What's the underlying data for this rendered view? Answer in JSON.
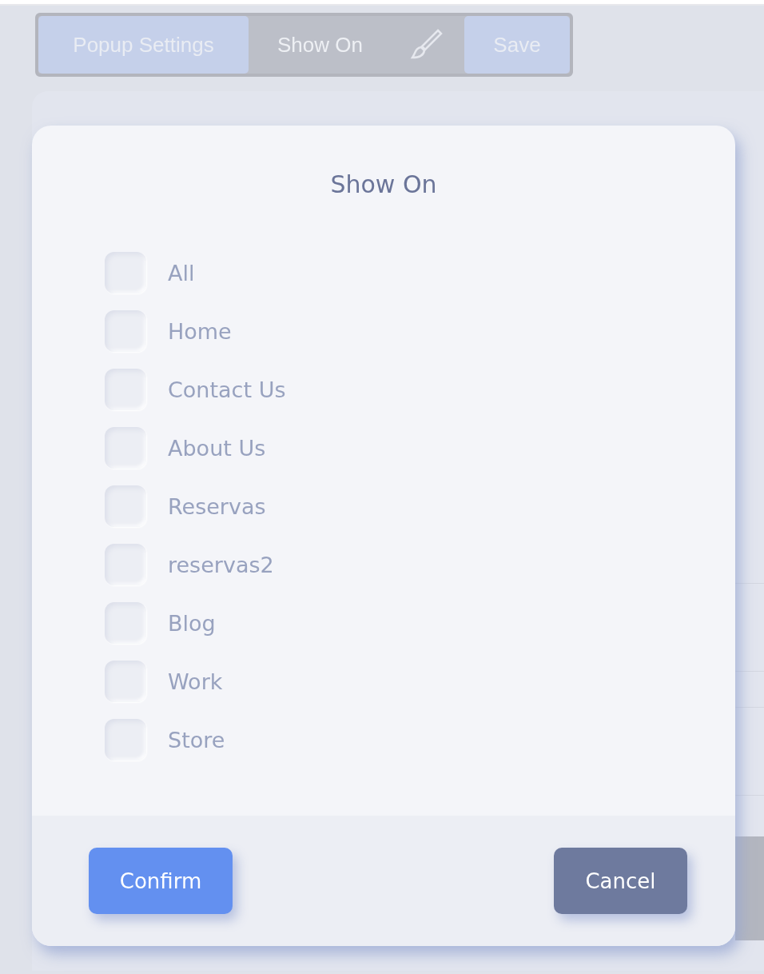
{
  "toolbar": {
    "tabs": [
      {
        "label": "Popup Settings",
        "selected": false
      },
      {
        "label": "Show On",
        "selected": true
      }
    ],
    "save": "Save"
  },
  "dialog": {
    "title": "Show On",
    "options": [
      {
        "label": "All",
        "checked": false
      },
      {
        "label": "Home",
        "checked": false
      },
      {
        "label": "Contact Us",
        "checked": false
      },
      {
        "label": "About Us",
        "checked": false
      },
      {
        "label": "Reservas",
        "checked": false
      },
      {
        "label": "reservas2",
        "checked": false
      },
      {
        "label": "Blog",
        "checked": false
      },
      {
        "label": "Work",
        "checked": false
      },
      {
        "label": "Store",
        "checked": false
      }
    ],
    "buttons": [
      {
        "label": "Confirm",
        "kind": "primary"
      },
      {
        "label": "Cancel",
        "kind": "secondary"
      }
    ]
  }
}
